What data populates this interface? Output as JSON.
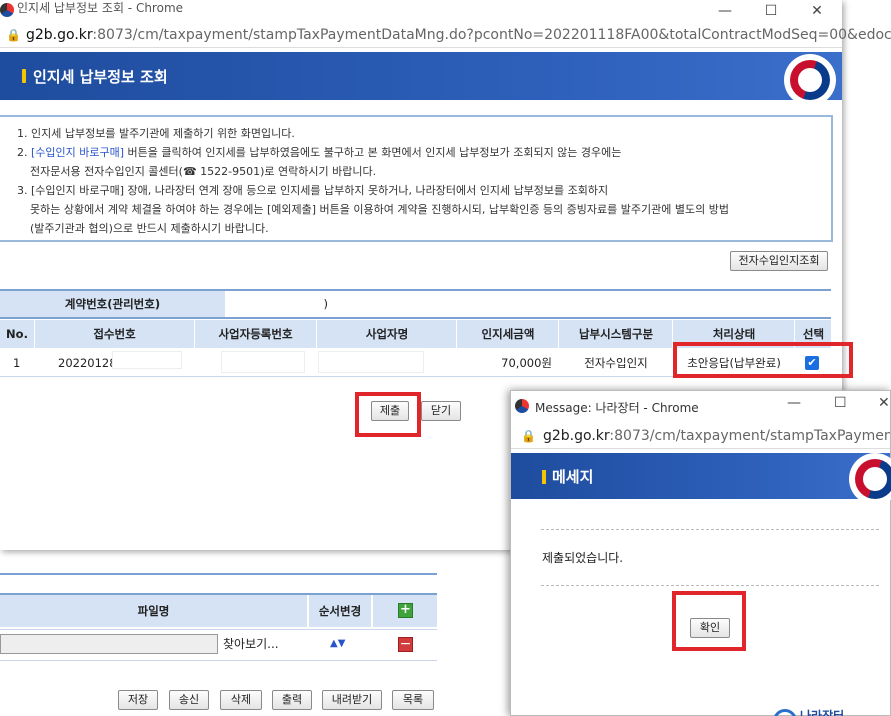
{
  "main_window": {
    "title": "인지세 납부정보 조회 - Chrome",
    "url_domain": "g2b.go.kr",
    "url_rest": ":8073/cm/taxpayment/stampTaxPaymentDataMng.do?pcontNo=202201118FA00&totalContractModSeq=00&edocC...",
    "header": "인지세 납부정보 조회",
    "info": {
      "line1": "1. 인지세 납부정보를 발주기관에 제출하기 위한 화면입니다.",
      "line2_prefix": "2. ",
      "line2_link": "[수입인지 바로구매]",
      "line2_rest": " 버튼을 클릭하여 인지세를 납부하였음에도 불구하고 본 화면에서 인지세 납부정보가 조회되지 않는 경우에는",
      "line3": "전자문서용 전자수입인지 콜센터(☎ 1522-9501)로 연락하시기 바랍니다.",
      "line4": "3. [수입인지 바로구매] 장애, 나라장터 연계 장애 등으로 인지세를 납부하지 못하거나, 나라장터에서 인지세 납부정보를 조회하지",
      "line5": "못하는 상황에서 계약 체결을 하여야 하는 경우에는 [예외제출] 버튼을 이용하여 계약을 진행하시되, 납부확인증 등의 증빙자료를 발주기관에 별도의 방법",
      "line6": "(발주기관과 협의)으로 반드시 제출하시기 바랍니다."
    },
    "lookup_button": "전자수입인지조회",
    "contract_label": "계약번호(관리번호)",
    "contract_value": ")",
    "columns": [
      "No.",
      "접수번호",
      "사업자등록번호",
      "사업자명",
      "인지세금액",
      "납부시스템구분",
      "처리상태",
      "선택"
    ],
    "row": {
      "no": "1",
      "receipt_no": "202201281",
      "biz_no": "",
      "biz_name": "",
      "amount": "70,000원",
      "system": "전자수입인지",
      "status": "초안응답(납부완료)",
      "selected": true
    },
    "submit_button": "제출",
    "close_button": "닫기"
  },
  "bg_window": {
    "col_filename": "파일명",
    "col_order": "순서변경",
    "browse_button": "찾아보기...",
    "order_arrows": "▲▼",
    "buttons": [
      "저장",
      "송신",
      "삭제",
      "출력",
      "내려받기",
      "목록"
    ]
  },
  "popup": {
    "title": "Message: 나라장터 - Chrome",
    "url_domain": "g2b.go.kr",
    "url_rest": ":8073/cm/taxpayment/stampTaxPaymentSub...",
    "header": "메세지",
    "message": "제출되었습니다.",
    "ok_button": "확인",
    "logo_text": "나라장터"
  },
  "colors": {
    "banner": "#2f62bd",
    "highlight": "#e0262b",
    "table_header": "#d5e3f5",
    "accent": "#f5c400"
  }
}
